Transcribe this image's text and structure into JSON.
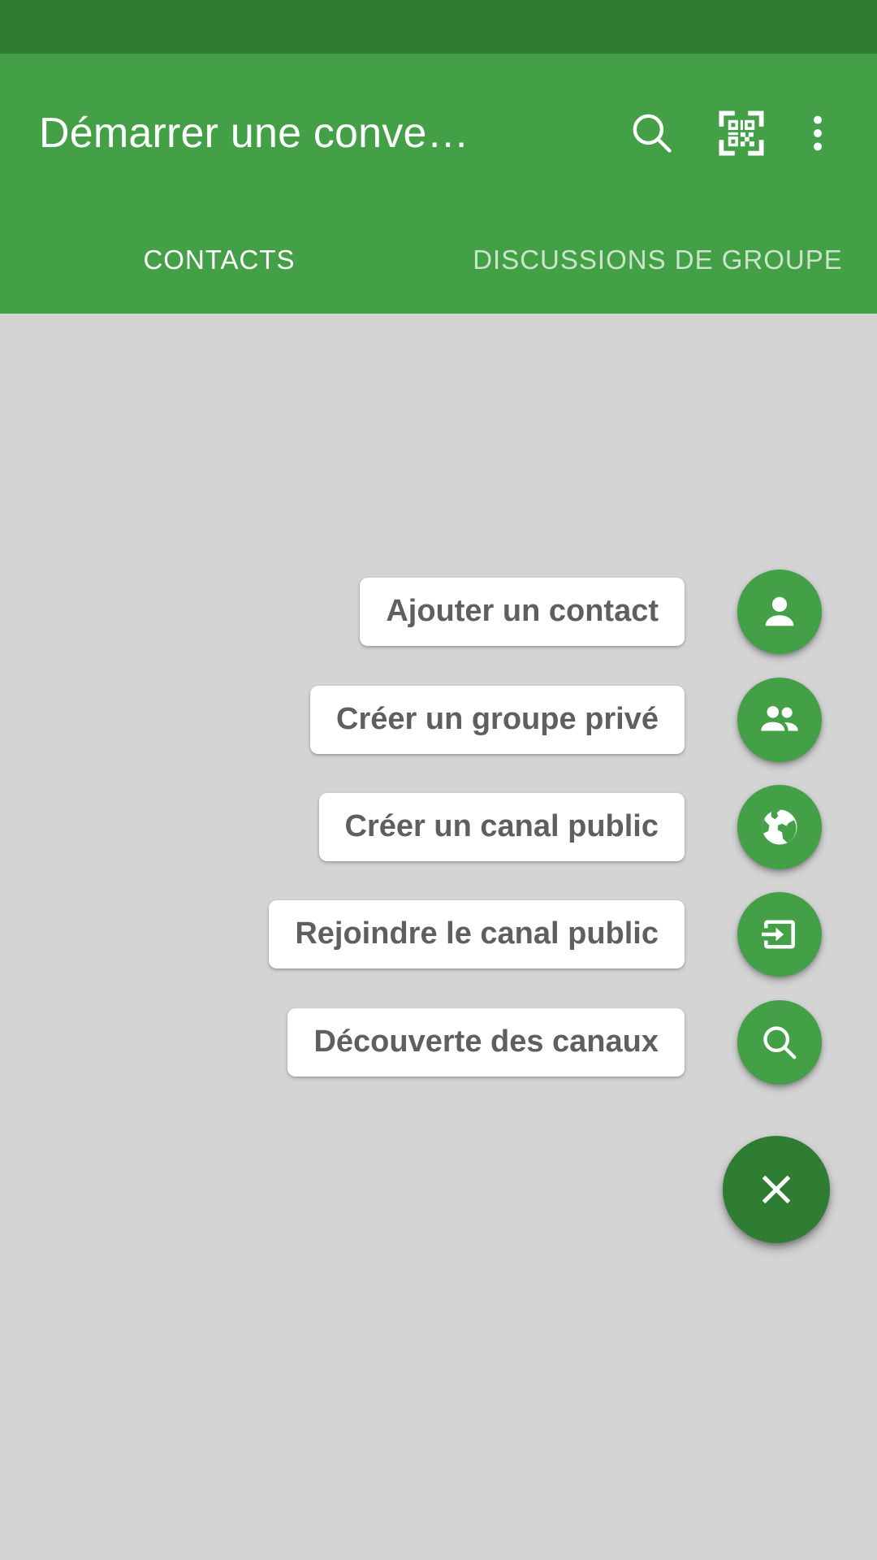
{
  "app_bar": {
    "title": "Démarrer une conve…",
    "actions": [
      {
        "name": "search-icon",
        "label": "Rechercher"
      },
      {
        "name": "qr-scan-icon",
        "label": "Scanner un QR code"
      },
      {
        "name": "overflow-menu-icon",
        "label": "Plus d'options"
      }
    ]
  },
  "tabs": [
    {
      "label": "CONTACTS",
      "active": true
    },
    {
      "label": "DISCUSSIONS DE GROUPE",
      "active": false
    }
  ],
  "speed_dial": {
    "expanded": true,
    "main_fab": {
      "icon": "close-icon",
      "label": "Fermer"
    },
    "items": [
      {
        "label": "Ajouter un contact",
        "icon": "person-add-icon"
      },
      {
        "label": "Créer un groupe privé",
        "icon": "people-group-icon"
      },
      {
        "label": "Créer un canal public",
        "icon": "globe-icon"
      },
      {
        "label": "Rejoindre le canal public",
        "icon": "login-arrow-icon"
      },
      {
        "label": "Découverte des canaux",
        "icon": "search-icon"
      }
    ]
  },
  "colors": {
    "status_bar": "#2e7d32",
    "app_bar": "#43a047",
    "accent": "#43a047",
    "main_fab": "#2e7d32",
    "scrim": "#d4d4d4",
    "tab_indicator": "#e3eee3",
    "label_text": "#5f5f5f",
    "label_bg": "#ffffff"
  }
}
